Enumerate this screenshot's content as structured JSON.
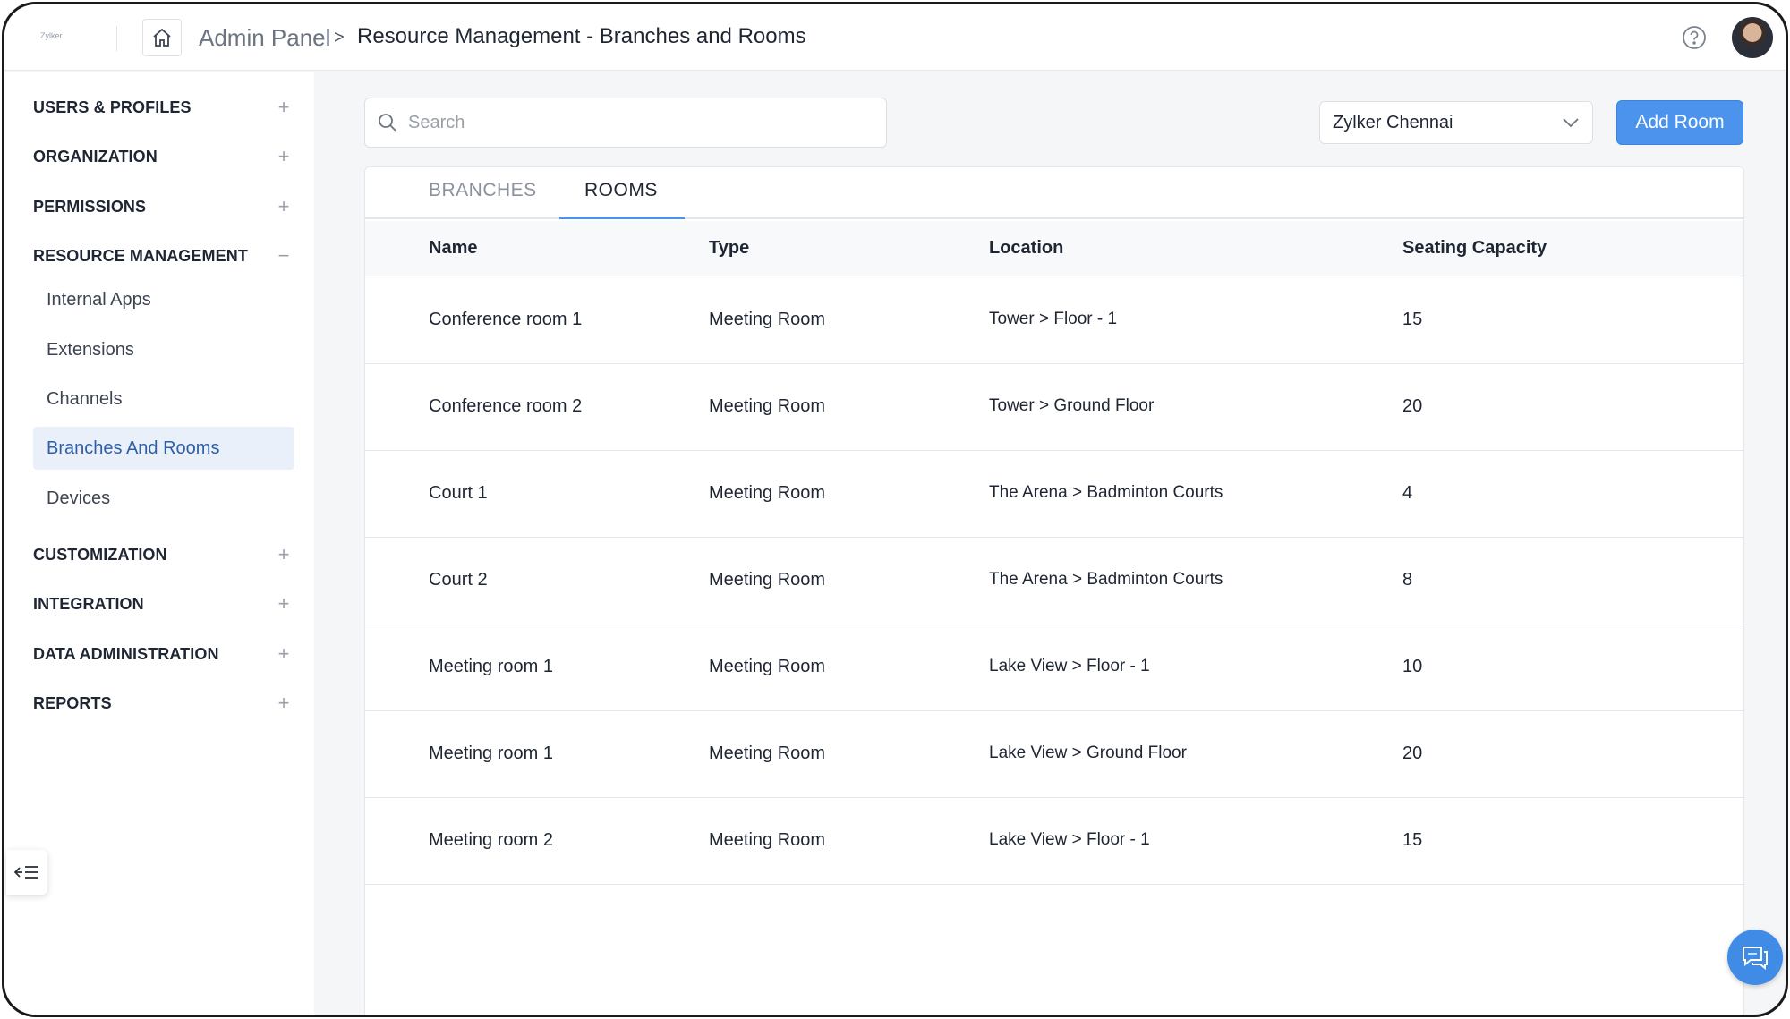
{
  "header": {
    "logo_text": "Zylker",
    "breadcrumb_root": "Admin Panel",
    "breadcrumb_separator": ">",
    "page_title": "Resource Management - Branches and Rooms"
  },
  "sidebar": {
    "groups_top": [
      {
        "label": "USERS & PROFILES",
        "toggle": "+"
      },
      {
        "label": "ORGANIZATION",
        "toggle": "+"
      },
      {
        "label": "PERMISSIONS",
        "toggle": "+"
      },
      {
        "label": "RESOURCE MANAGEMENT",
        "toggle": "−"
      }
    ],
    "sub_items": [
      {
        "label": "Internal Apps"
      },
      {
        "label": "Extensions"
      },
      {
        "label": "Channels"
      },
      {
        "label": "Branches And Rooms",
        "active": true
      },
      {
        "label": "Devices"
      }
    ],
    "groups_bottom": [
      {
        "label": "CUSTOMIZATION",
        "toggle": "+"
      },
      {
        "label": "INTEGRATION",
        "toggle": "+"
      },
      {
        "label": "DATA ADMINISTRATION",
        "toggle": "+"
      },
      {
        "label": "REPORTS",
        "toggle": "+"
      }
    ],
    "collapse_icon": "collapse-sidebar-icon"
  },
  "toolbar": {
    "search_placeholder": "Search",
    "search_value": "",
    "branch_selected": "Zylker Chennai",
    "add_button_label": "Add Room"
  },
  "tabs": [
    {
      "label": "BRANCHES",
      "active": false
    },
    {
      "label": "ROOMS",
      "active": true
    }
  ],
  "table": {
    "columns": [
      "Name",
      "Type",
      "Location",
      "Seating Capacity"
    ],
    "rows": [
      {
        "name": "Conference room 1",
        "type": "Meeting Room",
        "location": "Tower > Floor - 1",
        "capacity": "15"
      },
      {
        "name": "Conference room 2",
        "type": "Meeting Room",
        "location": "Tower > Ground Floor",
        "capacity": "20"
      },
      {
        "name": "Court 1",
        "type": "Meeting Room",
        "location": "The Arena > Badminton Courts",
        "capacity": "4"
      },
      {
        "name": "Court 2",
        "type": "Meeting Room",
        "location": "The Arena > Badminton Courts",
        "capacity": "8"
      },
      {
        "name": "Meeting room 1",
        "type": "Meeting Room",
        "location": "Lake View > Floor - 1",
        "capacity": "10"
      },
      {
        "name": "Meeting room 1",
        "type": "Meeting Room",
        "location": "Lake View > Ground Floor",
        "capacity": "20"
      },
      {
        "name": "Meeting room 2",
        "type": "Meeting Room",
        "location": "Lake View > Floor - 1",
        "capacity": "15"
      }
    ]
  },
  "colors": {
    "accent": "#4b93ec",
    "active_nav_bg": "#e9f0fa",
    "active_nav_text": "#2c5fa8"
  }
}
